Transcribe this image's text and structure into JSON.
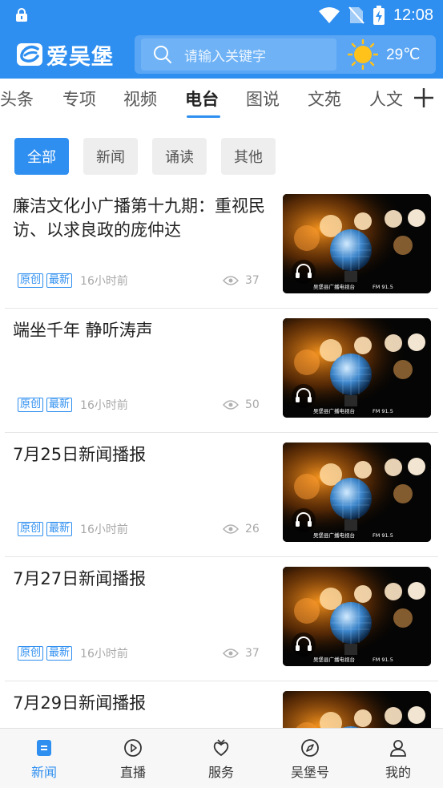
{
  "status_bar": {
    "time": "12:08"
  },
  "header": {
    "app_name": "爱吴堡",
    "search_placeholder": "请输入关键字",
    "temperature": "29℃"
  },
  "tabs": [
    {
      "label": "头条"
    },
    {
      "label": "专项"
    },
    {
      "label": "视频"
    },
    {
      "label": "电台",
      "active": true
    },
    {
      "label": "图说"
    },
    {
      "label": "文苑"
    },
    {
      "label": "人文"
    }
  ],
  "filters": [
    {
      "label": "全部",
      "active": true
    },
    {
      "label": "新闻"
    },
    {
      "label": "诵读"
    },
    {
      "label": "其他"
    }
  ],
  "thumb_caption": {
    "station": "吴堡县广播电视台",
    "freq": "FM 91.5"
  },
  "articles": [
    {
      "title": "廉洁文化小广播第十九期：重视民访、以求良政的庞仲达",
      "tags": [
        "原创",
        "最新"
      ],
      "time": "16小时前",
      "views": "37"
    },
    {
      "title": "端坐千年 静听涛声",
      "tags": [
        "原创",
        "最新"
      ],
      "time": "16小时前",
      "views": "50"
    },
    {
      "title": "7月25日新闻播报",
      "tags": [
        "原创",
        "最新"
      ],
      "time": "16小时前",
      "views": "26"
    },
    {
      "title": "7月27日新闻播报",
      "tags": [
        "原创",
        "最新"
      ],
      "time": "16小时前",
      "views": "37"
    },
    {
      "title": "7月29日新闻播报"
    }
  ],
  "bottom_nav": [
    {
      "label": "新闻",
      "icon": "news-icon",
      "active": true
    },
    {
      "label": "直播",
      "icon": "play-circle-icon"
    },
    {
      "label": "服务",
      "icon": "service-icon"
    },
    {
      "label": "吴堡号",
      "icon": "compass-icon"
    },
    {
      "label": "我的",
      "icon": "user-icon"
    }
  ],
  "colors": {
    "brand": "#2f8ff0",
    "tag": "#2f8ff0",
    "muted": "#a8a8a8"
  }
}
